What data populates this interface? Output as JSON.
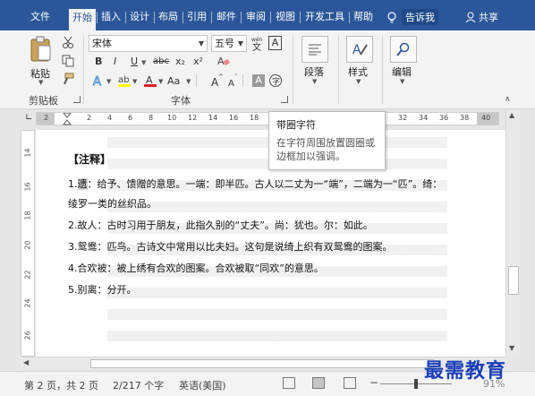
{
  "tabs": [
    "文件",
    "开始",
    "插入",
    "设计",
    "布局",
    "引用",
    "邮件",
    "审阅",
    "视图",
    "开发工具",
    "帮助"
  ],
  "tell_me": "告诉我",
  "share": "共享",
  "clipboard": {
    "paste": "粘贴",
    "group": "剪贴板"
  },
  "font": {
    "name": "宋体",
    "size": "五号",
    "group": "字体",
    "bold": "B",
    "italic": "I",
    "underline": "U",
    "strike": "abc",
    "sub": "x₂",
    "sup": "x²",
    "aa": "Aa"
  },
  "paragraph": {
    "label": "段落"
  },
  "styles": {
    "label": "样式"
  },
  "editing": {
    "label": "编辑"
  },
  "ruler": {
    "top_ticks": [
      "2",
      "2",
      "4",
      "6",
      "8",
      "10",
      "12",
      "14",
      "16",
      "18",
      "32",
      "34",
      "36",
      "38",
      "40"
    ],
    "left_ticks": [
      "14",
      "16",
      "18",
      "20",
      "22",
      "24",
      "26"
    ]
  },
  "tooltip": {
    "title": "带圈字符",
    "line1": "在字符周围放置圆圈或",
    "line2": "边框加以强调。"
  },
  "doc": {
    "heading": "【注释】",
    "line1_prefix": "1.",
    "line1_hl": "遗",
    "line1_rest": "：给予、馈赠的意思。一端：即半匹。古人以二丈为一“端”，二端为一“匹”。绮：",
    "line1_cont": "绫罗一类的丝织品。",
    "line2": "2.故人：古时习用于朋友，此指久别的“丈夫”。尚：犹也。尔：如此。",
    "line3": "3.鸳鸯：匹鸟。古诗文中常用以比夫妇。这句是说绮上织有双鸳鸯的图案。",
    "line4": "4.合欢被：被上绣有合欢的图案。合欢被取“同欢”的意思。",
    "line5": "5.别离：分开。"
  },
  "status": {
    "page": "第 2 页，共 2 页",
    "words": "2/217 个字",
    "lang": "英语(美国)",
    "zoom": "91%"
  },
  "watermark": "最需教育",
  "colors": {
    "ribbon_blue": "#2b579a",
    "font_color_red": "#e02020",
    "highlight_yellow": "#ffff00"
  }
}
